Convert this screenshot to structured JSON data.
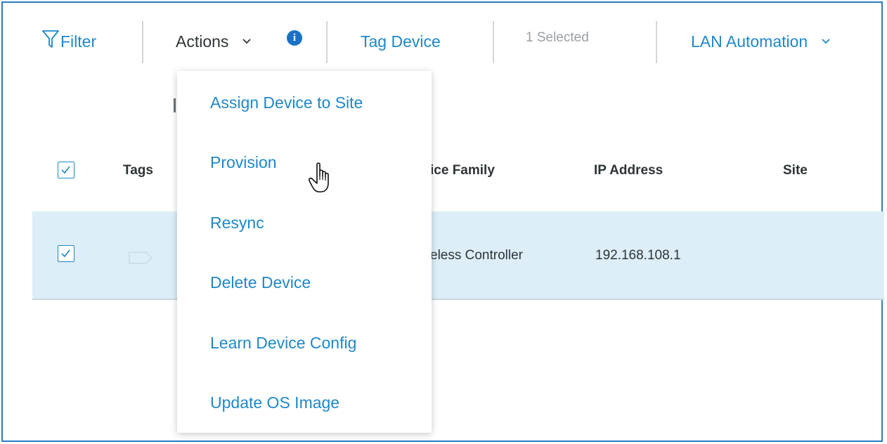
{
  "toolbar": {
    "filter_label": "Filter",
    "actions_label": "Actions",
    "tag_device_label": "Tag Device",
    "selected_text": "1 Selected",
    "lan_automation_label": "LAN Automation"
  },
  "table": {
    "columns": {
      "tags": "Tags",
      "device_family": "ice Family",
      "ip_address": "IP Address",
      "site": "Site"
    },
    "rows": [
      {
        "device_family": "eless Controller",
        "ip_address": "192.168.108.1",
        "site": ""
      }
    ]
  },
  "actions_menu": {
    "items": [
      "Assign Device to Site",
      "Provision",
      "Resync",
      "Delete Device",
      "Learn Device Config",
      "Update OS Image"
    ],
    "hovered_item": "Provision"
  },
  "colors": {
    "accent": "#1f88c9",
    "frame_border": "#2e7bc4",
    "selected_row": "#ddeef8",
    "info_badge": "#1a72c6"
  },
  "icons": [
    "filter-icon",
    "chevron-down-icon",
    "info-icon",
    "checkbox-icon",
    "tag-icon",
    "hand-pointer-icon"
  ]
}
